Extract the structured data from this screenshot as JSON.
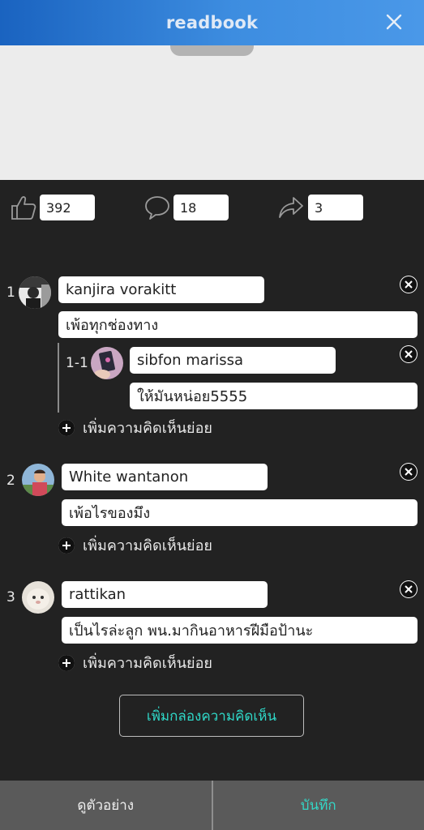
{
  "header": {
    "title": "readbook"
  },
  "stats": {
    "likes": "392",
    "comments": "18",
    "shares": "3"
  },
  "comments": [
    {
      "number": "1",
      "name": "kanjira vorakitt",
      "text": "เพ้อทุกช่องทาง",
      "replies": [
        {
          "number": "1-1",
          "name": "sibfon marissa",
          "text": "ให้มันหน่อย5555"
        }
      ],
      "add_reply_label": "เพิ่มความคิดเห็นย่อย"
    },
    {
      "number": "2",
      "name": "White wantanon",
      "text": "เพ้อไรของมึง",
      "replies": [],
      "add_reply_label": "เพิ่มความคิดเห็นย่อย"
    },
    {
      "number": "3",
      "name": "rattikan",
      "text": "เป็นไรล่ะลูก พน.มากินอาหารฝีมือป้านะ",
      "replies": [],
      "add_reply_label": "เพิ่มความคิดเห็นย่อย"
    }
  ],
  "add_comment_box_label": "เพิ่มกล่องความคิดเห็น",
  "footer": {
    "preview_label": "ดูตัวอย่าง",
    "save_label": "บันทึก"
  },
  "colors": {
    "header_start": "#1a63c0",
    "header_end": "#4a98e8",
    "accent": "#34d6c6",
    "background": "#222222"
  }
}
